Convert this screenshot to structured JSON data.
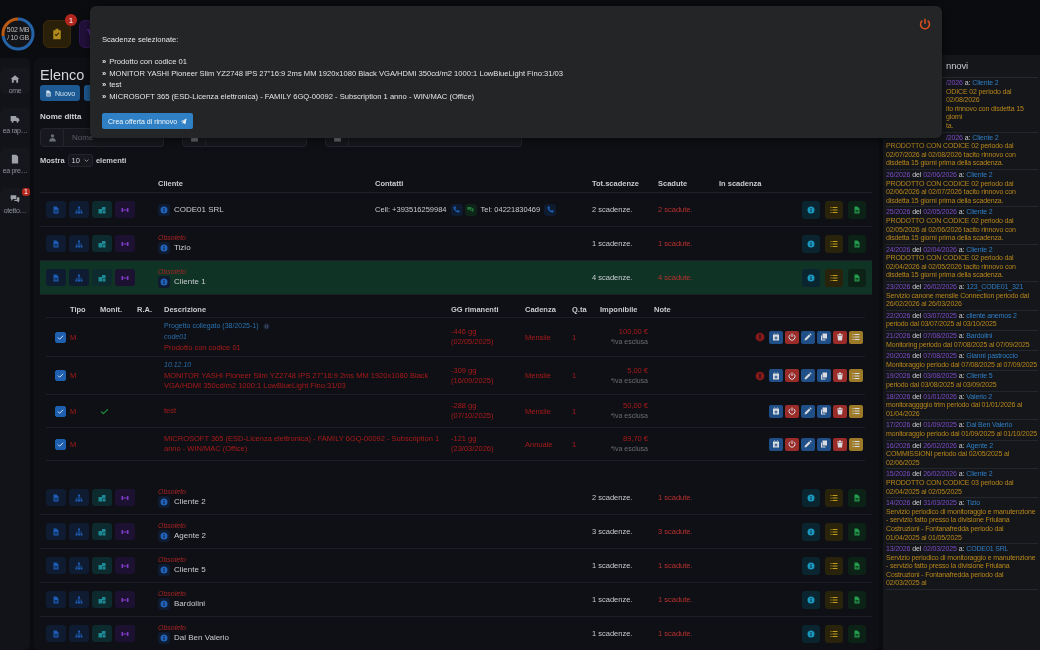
{
  "topbar": {
    "storage": {
      "used": "502 MB",
      "total": "/ 10 GB",
      "level": 0.72
    },
    "tasks_badge": "1"
  },
  "sidebar": {
    "items": [
      {
        "kind": "home",
        "label": "ome"
      },
      {
        "kind": "truck",
        "label": "ea rap…"
      },
      {
        "kind": "document",
        "label": "ea pre…"
      },
      {
        "kind": "chat",
        "label": "otetto…",
        "badge": "1"
      }
    ]
  },
  "page": {
    "title": "Elenco",
    "new_button": "Nuovo"
  },
  "filters": {
    "label": "Nome ditta",
    "fields": [
      {
        "kind": "user",
        "placeholder": "Nome"
      },
      {
        "kind": "calendar"
      },
      {
        "kind": "calendar"
      }
    ]
  },
  "length_menu": {
    "before": "Mostra",
    "value": "10",
    "after": "elementi"
  },
  "table": {
    "columns": [
      "Cliente",
      "Contatti",
      "Tot.scadenze",
      "Scadute",
      "In scadenza"
    ],
    "rows": [
      {
        "client": "CODE01 SRL",
        "contacts": [
          {
            "text": "Cell: +393516259984",
            "actions": [
              {
                "kind": "phone"
              },
              {
                "kind": "chat"
              }
            ]
          },
          {
            "text": "Tel: 04221830469",
            "actions": [
              {
                "kind": "phone"
              }
            ]
          }
        ],
        "total": "2 scadenze.",
        "expired": "2 scadute.",
        "selected": false
      },
      {
        "status": "Obsoleto",
        "client": "Tizio",
        "total": "1 scadenze.",
        "expired": "1 scadute.",
        "selected": false
      },
      {
        "status": "Obsoleto",
        "client": "Cliente 1",
        "total": "4 scadenze.",
        "expired": "4 scadute.",
        "selected": true,
        "details": {
          "columns": [
            "Tipo",
            "Monit.",
            "R.A.",
            "Descrizione",
            "GG rimanenti",
            "Cadenza",
            "Q.ta",
            "Imponibile",
            "Note"
          ],
          "rows": [
            {
              "checked": true,
              "type": "M",
              "monitored": false,
              "project": "Progetto collegato (38/2025-1)",
              "code": "code01",
              "description": "Prodotto con codice 01",
              "days": "-446 gg",
              "date": "(02/05/2025)",
              "cadence": "Mensile",
              "qty": "1",
              "amount": "100,00 €",
              "vat_note": "*iva esclusa",
              "alert": true
            },
            {
              "checked": true,
              "type": "M",
              "monitored": false,
              "code": "10.12.10",
              "description": "MONITOR YASHI Pioneer Slim YZ2748 IPS 27\"16:9 2ms MM 1920x1080 Black VGA/HDMI 350cd/m2 1000:1 LowBlueLight Fino:31/03",
              "days": "-309 gg",
              "date": "(16/09/2025)",
              "cadence": "Mensile",
              "qty": "1",
              "amount": "5,00 €",
              "vat_note": "*iva esclusa",
              "alert": true
            },
            {
              "checked": true,
              "type": "M",
              "monitored": true,
              "description": "test",
              "days": "-288 gg",
              "date": "(07/10/2025)",
              "cadence": "Mensile",
              "qty": "1",
              "amount": "50,00 €",
              "vat_note": "*iva esclusa",
              "alert": false
            },
            {
              "checked": true,
              "type": "M",
              "monitored": false,
              "description": "MICROSOFT 365 (ESD-Licenza elettronica) - FAMILY 6GQ-00092 - Subscription 1 anno - WIN/MAC (Office)",
              "days": "-121 gg",
              "date": "(23/03/2026)",
              "cadence": "Annuale",
              "qty": "1",
              "amount": "89,70 €",
              "vat_note": "*iva esclusa",
              "alert": false
            }
          ]
        }
      },
      {
        "status": "Obsoleto",
        "client": "Cliente 2",
        "total": "2 scadenze.",
        "expired": "1 scadute.",
        "selected": false
      },
      {
        "status": "Obsoleto",
        "client": "Agente 2",
        "total": "3 scadenze.",
        "expired": "3 scadute.",
        "selected": false
      },
      {
        "status": "Obsoleto",
        "client": "Cliente 5",
        "total": "1 scadenze.",
        "expired": "1 scadute.",
        "selected": false
      },
      {
        "status": "Obsoleto",
        "client": "Bardolini",
        "total": "1 scadenze.",
        "expired": "1 scadute.",
        "selected": false
      },
      {
        "status": "Obsoleto",
        "client": "Dal Ben Valerio",
        "total": "1 scadenze.",
        "expired": "1 scadute.",
        "selected": false
      }
    ]
  },
  "renewals": {
    "title": "nnovi",
    "items": [
      {
        "kind": "cut",
        "number": "/2026",
        "client_label": "a:",
        "client": "Cliente 2",
        "lines": [
          "ODICE 02 periodo dal 02/08/2026",
          "ito rinnovo con disdetta 15 giorni",
          "ta."
        ]
      },
      {
        "kind": "cut",
        "number": "/2026",
        "client_label": "a:",
        "client": "Cliente 2",
        "text": "PRODOTTO CON CODICE 02 periodo dal 02/07/2026 al 02/08/2026 tacito rinnovo con disdetta 15 giorni prima della scadenza."
      },
      {
        "kind": "full",
        "number": "26/2026",
        "date_label": "del",
        "date": "02/06/2026",
        "client_label": "a:",
        "client": "Cliente 2",
        "text": "PRODOTTO CON CODICE 02 periodo dal 02/06/2026 al 02/07/2026 tacito rinnovo con disdetta 15 giorni prima della scadenza."
      },
      {
        "kind": "full",
        "number": "25/2026",
        "date_label": "del",
        "date": "02/05/2026",
        "client_label": "a:",
        "client": "Cliente 2",
        "text": "PRODOTTO CON CODICE 02 periodo dal 02/05/2026 al 02/06/2026 tacito rinnovo con disdetta 15 giorni prima della scadenza."
      },
      {
        "kind": "full",
        "number": "24/2026",
        "date_label": "del",
        "date": "02/04/2026",
        "client_label": "a:",
        "client": "Cliente 2",
        "text": "PRODOTTO CON CODICE 02 periodo dal 02/04/2026 al 02/05/2026 tacito rinnovo con disdetta 15 giorni prima della scadenza."
      },
      {
        "kind": "full",
        "number": "23/2026",
        "date_label": "del",
        "date": "26/02/2026",
        "client_label": "a:",
        "client": "123_CODE01_321",
        "text": "Servizio canone mensile Connection periodo dal 26/02/2026 al 26/03/2026"
      },
      {
        "kind": "full",
        "number": "22/2026",
        "date_label": "del",
        "date": "03/07/2025",
        "client_label": "a:",
        "client": "cliente anemos 2",
        "text": "periodo dal 03/07/2025 al 03/10/2025"
      },
      {
        "kind": "full",
        "number": "21/2026",
        "date_label": "del",
        "date": "07/08/2025",
        "client_label": "a:",
        "client": "Bardolini",
        "text": "Monitoring periodo dal 07/08/2025 al 07/09/2025"
      },
      {
        "kind": "full",
        "number": "20/2026",
        "date_label": "del",
        "date": "07/08/2025",
        "client_label": "a:",
        "client": "Gianni pastroccio",
        "text": "Monitoraggio periodo dal 07/08/2025 al 07/09/2025"
      },
      {
        "kind": "full",
        "number": "19/2026",
        "date_label": "del",
        "date": "03/08/2025",
        "client_label": "a:",
        "client": "Cliente 5",
        "text": "periodo dal 03/08/2025 al 03/09/2025"
      },
      {
        "kind": "full",
        "number": "18/2026",
        "date_label": "del",
        "date": "01/01/2026",
        "client_label": "a:",
        "client": "Valerio 2",
        "text": "monitoraggggio trim periodo dal 01/01/2026 al 01/04/2026"
      },
      {
        "kind": "full",
        "number": "17/2026",
        "date_label": "del",
        "date": "01/09/2025",
        "client_label": "a:",
        "client": "Dal Ben Valerio",
        "text": "monitoraggio periodo dal 01/09/2025 al 01/10/2025"
      },
      {
        "kind": "full",
        "number": "16/2026",
        "date_label": "del",
        "date": "26/02/2026",
        "client_label": "a:",
        "client": "Agente 2",
        "text": "COMMISSIONI periodo dal 02/05/2025 al 02/06/2025"
      },
      {
        "kind": "full",
        "number": "15/2026",
        "date_label": "del",
        "date": "26/02/2026",
        "client_label": "a:",
        "client": "Cliente 2",
        "text": "PRODOTTO CON CODICE 03 periodo dal 02/04/2025 al 02/05/2025"
      },
      {
        "kind": "full",
        "number": "14/2026",
        "date_label": "del",
        "date": "31/03/2025",
        "client_label": "a:",
        "client": "Tizio",
        "text": "Servizio periodico di monitoraggio e manutenzione - servizio fatto presso la divisione Friulana Costruzioni - Fontanafredda periodo dal 01/04/2025 al 01/05/2025"
      },
      {
        "kind": "full",
        "number": "13/2026",
        "date_label": "del",
        "date": "02/03/2025",
        "client_label": "a:",
        "client": "CODE01 SRL",
        "text": "Servizio periodico di monitoraggio e manutenzione - servizio fatto presso la divisione Friulana Costruzioni - Fontanafredda periodo dal 02/03/2025 al"
      }
    ]
  },
  "modal": {
    "title": "Scadenze selezionate:",
    "items": [
      {
        "marker": "»",
        "text": "Prodotto con codice 01"
      },
      {
        "marker": "»",
        "text": "MONITOR YASHI Pioneer Slim YZ2748 IPS 27\"16:9 2ms MM 1920x1080 Black VGA/HDMI 350cd/m2 1000:1 LowBlueLight Fino:31/03"
      },
      {
        "marker": "»",
        "text": "test"
      },
      {
        "marker": "»",
        "text": "MICROSOFT 365 (ESD-Licenza elettronica) - FAMILY 6GQ-00092 - Subscription 1 anno - WIN/MAC (Office)"
      }
    ],
    "button": "Crea offerta di rinnovo"
  }
}
